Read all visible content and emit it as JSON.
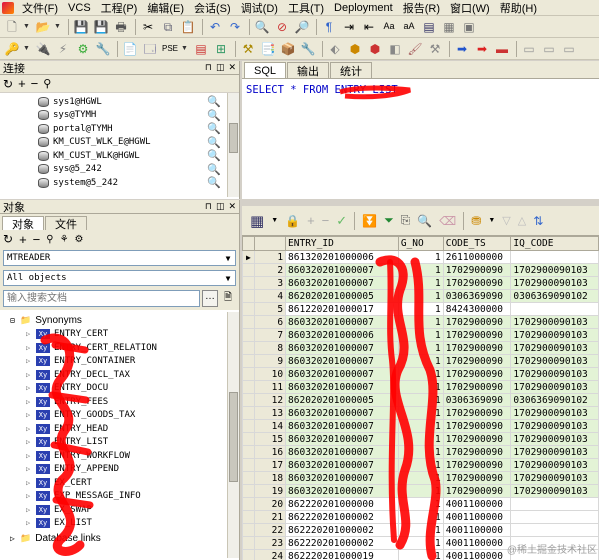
{
  "menubar": {
    "items": [
      "文件(F)",
      "VCS",
      "工程(P)",
      "编辑(E)",
      "会话(S)",
      "调试(D)",
      "工具(T)",
      "Deployment",
      "报告(R)",
      "窗口(W)",
      "帮助(H)"
    ]
  },
  "connections_panel": {
    "title": "连接",
    "items": [
      "sys1@HGWL",
      "sys@TYMH",
      "portal@TYMH",
      "KM_CUST_WLK_E@HGWL",
      "KM_CUST_WLK@HGWL",
      "sys@5_242",
      "system@5_242"
    ]
  },
  "objects_panel": {
    "title": "对象",
    "tabs": [
      "对象",
      "文件"
    ],
    "schema_value": "MTREADER",
    "type_value": "All objects",
    "search_placeholder": "输入搜索文档",
    "tree_root": "Synonyms",
    "tree_items": [
      "ENTRY_CERT",
      "ENTRY_CERT_RELATION",
      "ENTRY_CONTAINER",
      "ENTRY_DECL_TAX",
      "ENTRY_DOCU",
      "ENTRY_FEES",
      "ENTRY_GOODS_TAX",
      "ENTRY_HEAD",
      "ENTRY_LIST",
      "ENTRY_WORKFLOW",
      "ENTRY_APPEND",
      "EX_CERT",
      "EXP_MESSAGE_INFO",
      "EX_SWAP",
      "EX_LIST"
    ],
    "tree_footer": "Database links"
  },
  "editor": {
    "tabs": [
      "SQL",
      "输出",
      "统计"
    ],
    "sql_text": "SELECT * FROM ENTRY_LIST"
  },
  "grid": {
    "columns": [
      "ENTRY_ID",
      "G_NO",
      "CODE_TS",
      "IQ_CODE"
    ],
    "rows": [
      {
        "n": "1",
        "entry_id": "861320201000006",
        "g_no": "1",
        "code_ts": "2611000000",
        "iq_code": ""
      },
      {
        "n": "2",
        "entry_id": "860320201000007",
        "g_no": "1",
        "code_ts": "1702900090",
        "iq_code": "1702900090103"
      },
      {
        "n": "3",
        "entry_id": "860320201000007",
        "g_no": "1",
        "code_ts": "1702900090",
        "iq_code": "1702900090103"
      },
      {
        "n": "4",
        "entry_id": "862020201000005",
        "g_no": "1",
        "code_ts": "0306369090",
        "iq_code": "0306369090102"
      },
      {
        "n": "5",
        "entry_id": "861220201000017",
        "g_no": "1",
        "code_ts": "8424300000",
        "iq_code": ""
      },
      {
        "n": "6",
        "entry_id": "860320201000007",
        "g_no": "1",
        "code_ts": "1702900090",
        "iq_code": "1702900090103"
      },
      {
        "n": "7",
        "entry_id": "860320201000006",
        "g_no": "1",
        "code_ts": "1702900090",
        "iq_code": "1702900090103"
      },
      {
        "n": "8",
        "entry_id": "860320201000007",
        "g_no": "1",
        "code_ts": "1702900090",
        "iq_code": "1702900090103"
      },
      {
        "n": "9",
        "entry_id": "860320201000007",
        "g_no": "1",
        "code_ts": "1702900090",
        "iq_code": "1702900090103"
      },
      {
        "n": "10",
        "entry_id": "860320201000007",
        "g_no": "1",
        "code_ts": "1702900090",
        "iq_code": "1702900090103"
      },
      {
        "n": "11",
        "entry_id": "860320201000007",
        "g_no": "1",
        "code_ts": "1702900090",
        "iq_code": "1702900090103"
      },
      {
        "n": "12",
        "entry_id": "862020201000005",
        "g_no": "1",
        "code_ts": "0306369090",
        "iq_code": "0306369090102"
      },
      {
        "n": "13",
        "entry_id": "860320201000007",
        "g_no": "1",
        "code_ts": "1702900090",
        "iq_code": "1702900090103"
      },
      {
        "n": "14",
        "entry_id": "860320201000007",
        "g_no": "1",
        "code_ts": "1702900090",
        "iq_code": "1702900090103"
      },
      {
        "n": "15",
        "entry_id": "860320201000007",
        "g_no": "1",
        "code_ts": "1702900090",
        "iq_code": "1702900090103"
      },
      {
        "n": "16",
        "entry_id": "860320201000007",
        "g_no": "1",
        "code_ts": "1702900090",
        "iq_code": "1702900090103"
      },
      {
        "n": "17",
        "entry_id": "860320201000007",
        "g_no": "1",
        "code_ts": "1702900090",
        "iq_code": "1702900090103"
      },
      {
        "n": "18",
        "entry_id": "860320201000007",
        "g_no": "1",
        "code_ts": "1702900090",
        "iq_code": "1702900090103"
      },
      {
        "n": "19",
        "entry_id": "860320201000007",
        "g_no": "1",
        "code_ts": "1702900090",
        "iq_code": "1702900090103"
      },
      {
        "n": "20",
        "entry_id": "862220201000000",
        "g_no": "1",
        "code_ts": "4001100000",
        "iq_code": ""
      },
      {
        "n": "21",
        "entry_id": "862220201000002",
        "g_no": "1",
        "code_ts": "4001100000",
        "iq_code": ""
      },
      {
        "n": "22",
        "entry_id": "862220201000002",
        "g_no": "1",
        "code_ts": "4001100000",
        "iq_code": ""
      },
      {
        "n": "23",
        "entry_id": "862220201000002",
        "g_no": "1",
        "code_ts": "4001100000",
        "iq_code": ""
      },
      {
        "n": "24",
        "entry_id": "862220201000019",
        "g_no": "1",
        "code_ts": "4001100000",
        "iq_code": ""
      }
    ]
  },
  "watermark": "@稀土掘金技术社区",
  "colors": {
    "highlight_row": "#e3f3d6",
    "annotation_red": "#ff0000"
  }
}
